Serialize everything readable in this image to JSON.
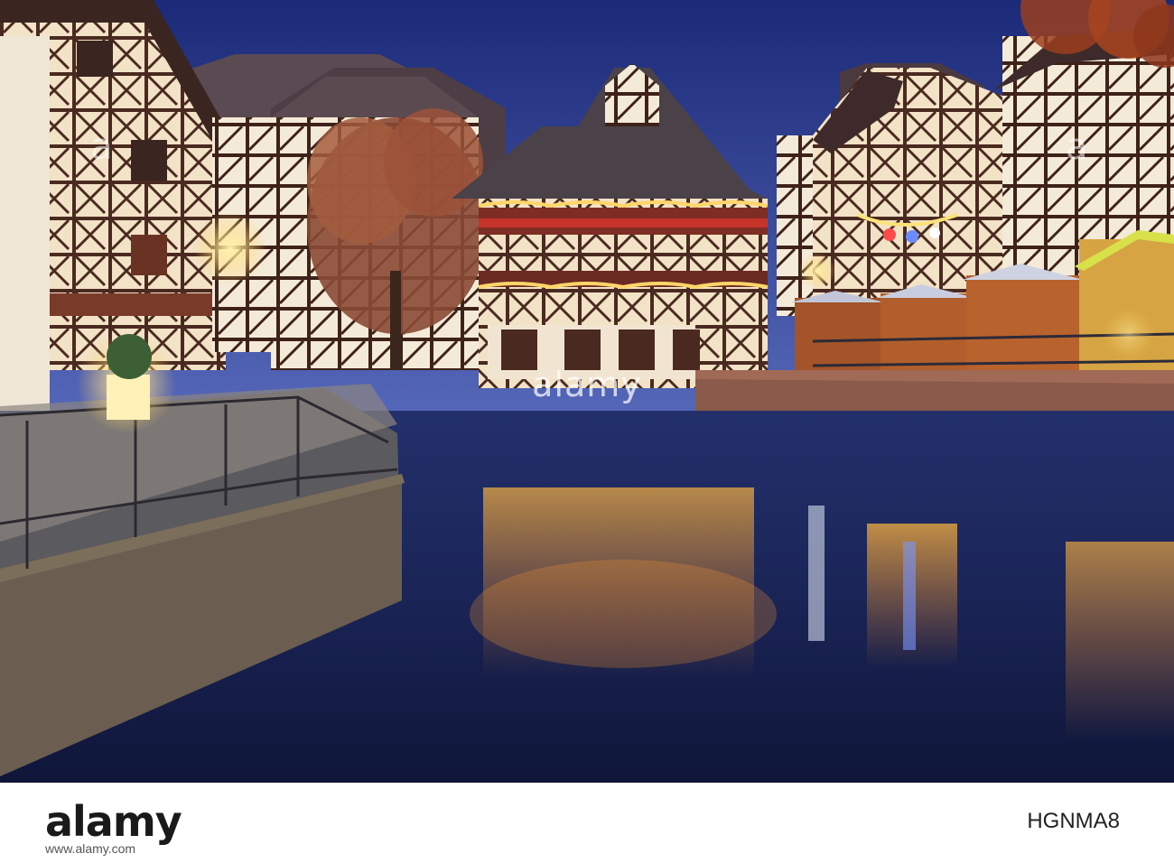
{
  "photo": {
    "description_alt": "",
    "colors": {
      "sky_top": "#1b2a78",
      "sky_bottom": "#4b5fb3",
      "water": "#16204f",
      "light_warm": "#ffcf5a",
      "light_red": "#d8342b",
      "stone": "#8a5a4a",
      "timber": "#4a2a20",
      "plaster": "#f2e7d6",
      "market_hut": "#b8622e"
    }
  },
  "watermark": {
    "center": "alamy",
    "left": "a",
    "right": "a"
  },
  "footer": {
    "logo": "alamy",
    "image_id": "HGNMA8",
    "url": "www.alamy.com"
  }
}
